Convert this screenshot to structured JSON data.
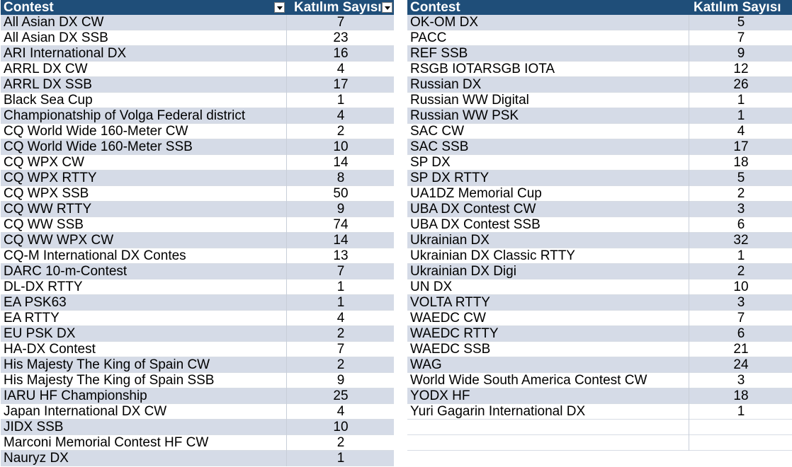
{
  "left_table": {
    "header": {
      "contest": "Contest",
      "count": "Katılım Sayısı"
    },
    "rows": [
      {
        "name": "All Asian DX CW",
        "count": "7"
      },
      {
        "name": "All Asian DX SSB",
        "count": "23"
      },
      {
        "name": "ARI International DX",
        "count": "16"
      },
      {
        "name": "ARRL DX CW",
        "count": "4"
      },
      {
        "name": "ARRL DX SSB",
        "count": "17"
      },
      {
        "name": "Black Sea Cup",
        "count": "1"
      },
      {
        "name": "Championatship of Volga Federal district",
        "count": "4"
      },
      {
        "name": "CQ World Wide 160-Meter CW",
        "count": "2"
      },
      {
        "name": "CQ World Wide 160-Meter SSB",
        "count": "10"
      },
      {
        "name": "CQ WPX CW",
        "count": "14"
      },
      {
        "name": "CQ WPX RTTY",
        "count": "8"
      },
      {
        "name": "CQ WPX SSB",
        "count": "50"
      },
      {
        "name": "CQ WW RTTY",
        "count": "9"
      },
      {
        "name": "CQ WW SSB",
        "count": "74"
      },
      {
        "name": "CQ WW WPX CW",
        "count": "14"
      },
      {
        "name": "CQ-M International DX Contes",
        "count": "13"
      },
      {
        "name": "DARC 10-m-Contest",
        "count": "7"
      },
      {
        "name": "DL-DX RTTY",
        "count": "1"
      },
      {
        "name": "EA PSK63",
        "count": "1"
      },
      {
        "name": "EA RTTY",
        "count": "4"
      },
      {
        "name": "EU PSK DX",
        "count": "2"
      },
      {
        "name": "HA-DX Contest",
        "count": "7"
      },
      {
        "name": "His Majesty The King of Spain CW",
        "count": "2"
      },
      {
        "name": "His Majesty The King of Spain SSB",
        "count": "9"
      },
      {
        "name": "IARU HF Championship",
        "count": "25"
      },
      {
        "name": "Japan International DX CW",
        "count": "4"
      },
      {
        "name": "JIDX  SSB",
        "count": "10"
      },
      {
        "name": "Marconi Memorial Contest HF CW",
        "count": "2"
      },
      {
        "name": "Nauryz DX",
        "count": "1"
      }
    ]
  },
  "right_table": {
    "header": {
      "contest": "Contest",
      "count": "Katılım Sayısı"
    },
    "rows": [
      {
        "name": "OK-OM DX",
        "count": "5"
      },
      {
        "name": "PACC",
        "count": "7"
      },
      {
        "name": "REF  SSB",
        "count": "9"
      },
      {
        "name": "RSGB IOTARSGB IOTA",
        "count": "12"
      },
      {
        "name": "Russian DX",
        "count": "26"
      },
      {
        "name": "Russian WW Digital",
        "count": "1"
      },
      {
        "name": "Russian WW PSK",
        "count": "1"
      },
      {
        "name": "SAC CW",
        "count": "4"
      },
      {
        "name": "SAC SSB",
        "count": "17"
      },
      {
        "name": "SP DX",
        "count": "18"
      },
      {
        "name": "SP DX RTTY",
        "count": "5"
      },
      {
        "name": "UA1DZ Memorial Cup",
        "count": "2"
      },
      {
        "name": "UBA DX Contest CW",
        "count": "3"
      },
      {
        "name": "UBA DX Contest SSB",
        "count": "6"
      },
      {
        "name": "Ukrainian DX",
        "count": "32"
      },
      {
        "name": "Ukrainian DX Classic RTTY",
        "count": "1"
      },
      {
        "name": "Ukrainian DX Digi",
        "count": "2"
      },
      {
        "name": "UN DX",
        "count": "10"
      },
      {
        "name": "VOLTA RTTY",
        "count": "3"
      },
      {
        "name": "WAEDC CW",
        "count": "7"
      },
      {
        "name": "WAEDC RTTY",
        "count": "6"
      },
      {
        "name": "WAEDC SSB",
        "count": "21"
      },
      {
        "name": "WAG",
        "count": "24"
      },
      {
        "name": "World Wide South America Contest CW",
        "count": "3"
      },
      {
        "name": "YODX HF",
        "count": "18"
      },
      {
        "name": "Yuri Gagarin International DX",
        "count": "1"
      }
    ]
  },
  "colors": {
    "header_bg": "#1f4e79",
    "band_bg": "#d5dbe7"
  }
}
